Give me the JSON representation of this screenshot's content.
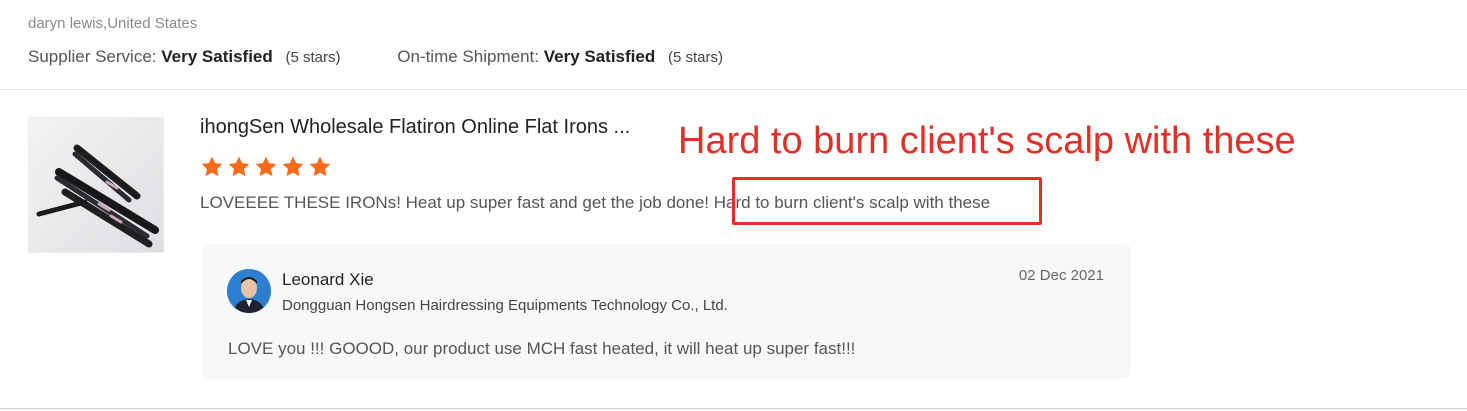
{
  "reviewer": {
    "meta": "daryn lewis,United States"
  },
  "ratings": [
    {
      "label": "Supplier Service:",
      "value": "Very Satisfied",
      "count": "(5 stars)"
    },
    {
      "label": "On-time Shipment:",
      "value": "Very Satisfied",
      "count": "(5 stars)"
    }
  ],
  "product": {
    "title": "ihongSen Wholesale Flatiron Online Flat Irons ...",
    "stars": 5,
    "star_color": "#f56a1b"
  },
  "review": {
    "text_main": "LOVEEEE THESE IRONs! Heat up super fast and get the job done! ",
    "text_highlight": "Hard to burn client's scalp with these"
  },
  "annotation": {
    "text": "Hard to burn client's scalp with these",
    "color": "#e03027"
  },
  "reply": {
    "name": "Leonard Xie",
    "company": "Dongguan Hongsen Hairdressing Equipments Technology Co., Ltd.",
    "date": "02 Dec 2021",
    "text": "LOVE you !!! GOOOD, our product use MCH fast heated, it will heat up super fast!!!"
  }
}
